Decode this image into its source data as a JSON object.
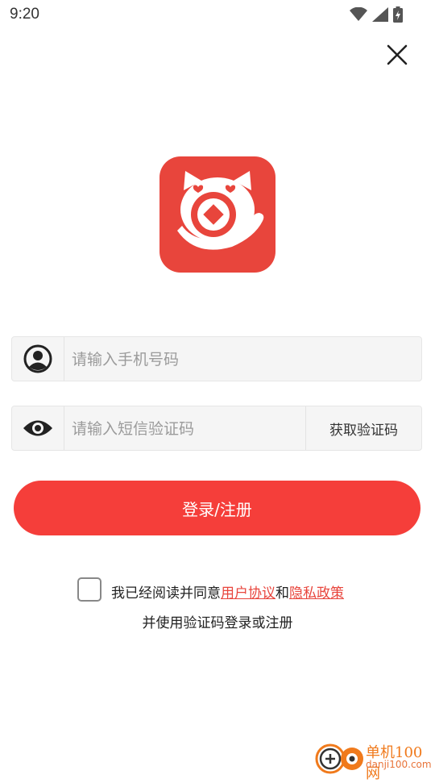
{
  "status_bar": {
    "time": "9:20",
    "icons": [
      "wifi-icon",
      "signal-icon",
      "battery-charging-icon"
    ]
  },
  "header": {
    "close_icon": "close-icon"
  },
  "logo": {
    "icon": "cat-coin-logo",
    "color": "#e8453c"
  },
  "form": {
    "phone_placeholder": "请输入手机号码",
    "phone_value": "",
    "phone_icon": "user-circle-icon",
    "code_placeholder": "请输入短信验证码",
    "code_value": "",
    "code_icon": "eye-icon",
    "get_code_label": "获取验证码"
  },
  "login_button": {
    "label": "登录/注册",
    "color": "#f53e3a"
  },
  "agreement": {
    "checked": false,
    "text_before": "我已经阅读并同意",
    "user_agreement": "用户协议",
    "and": "和",
    "privacy_policy": "隐私政策",
    "line2": "并使用验证码登录或注册"
  },
  "watermark": {
    "title": "单机100网",
    "url": "danji100.com"
  }
}
